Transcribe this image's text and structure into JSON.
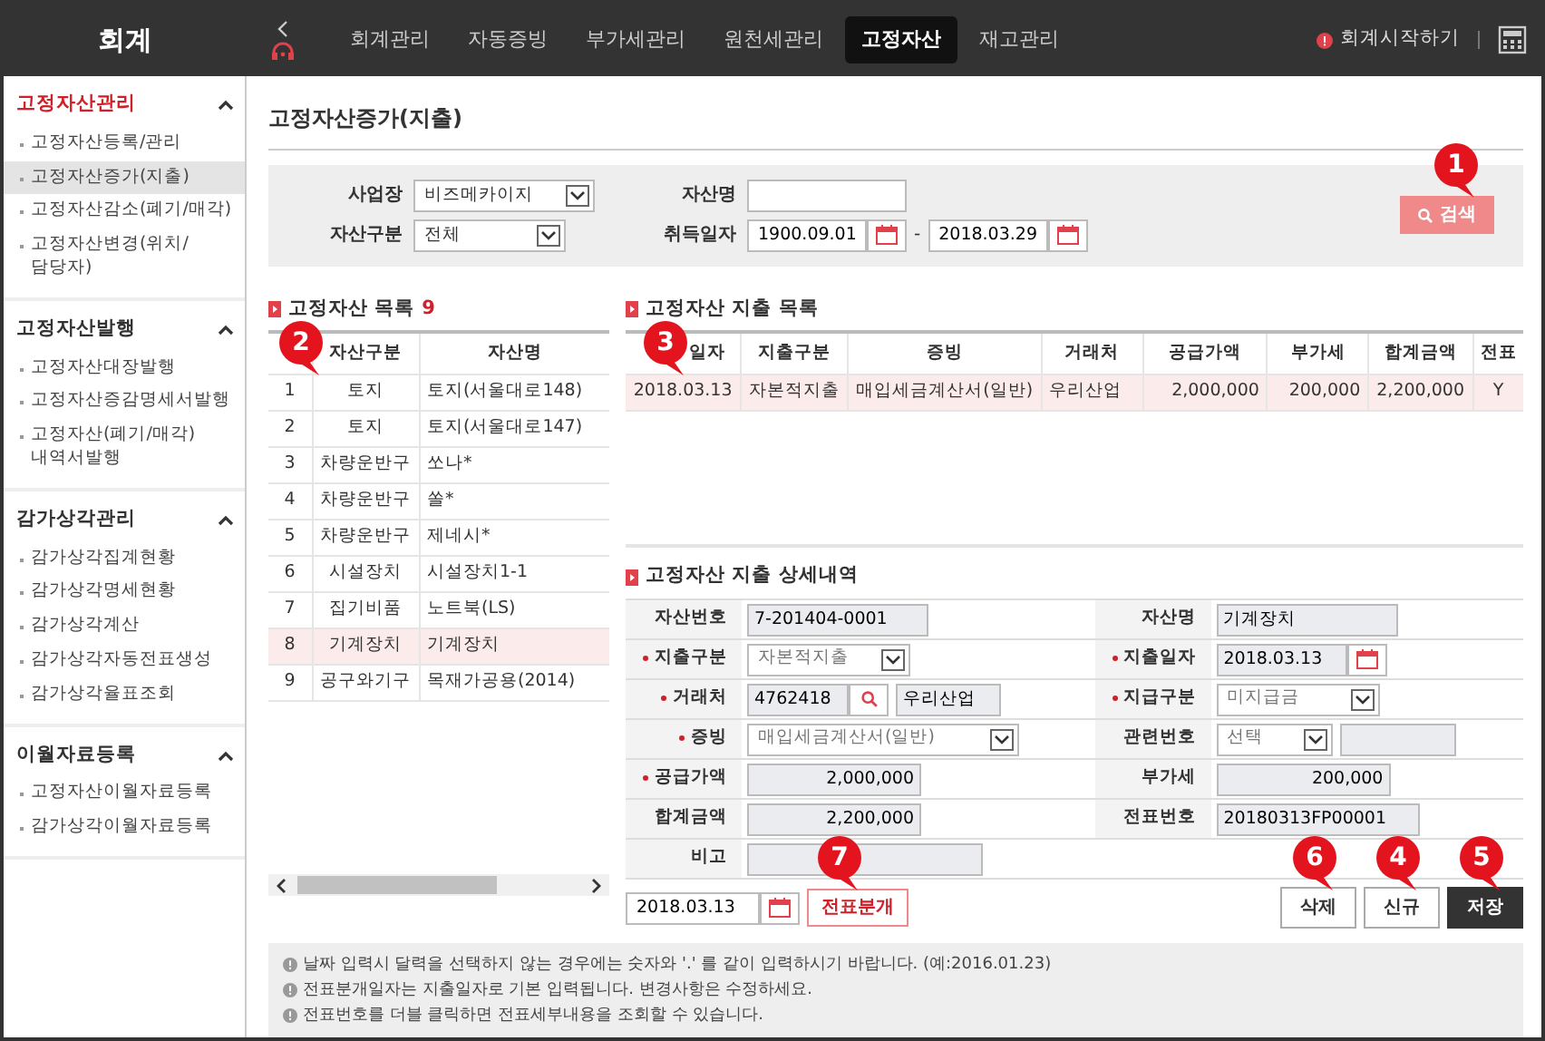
{
  "app": {
    "title": "회계",
    "start_link": "회계시작하기"
  },
  "nav_tabs": [
    {
      "label": "회계관리",
      "selected": false
    },
    {
      "label": "자동증빙",
      "selected": false
    },
    {
      "label": "부가세관리",
      "selected": false
    },
    {
      "label": "원천세관리",
      "selected": false
    },
    {
      "label": "고정자산",
      "selected": true
    },
    {
      "label": "재고관리",
      "selected": false
    }
  ],
  "sidebar": {
    "sections": [
      {
        "title": "고정자산관리",
        "selected": true,
        "expanded": true,
        "items": [
          {
            "label": "고정자산등록/관리",
            "selected": false
          },
          {
            "label": "고정자산증가(지출)",
            "selected": true
          },
          {
            "label": "고정자산감소(폐기/매각)",
            "selected": false
          },
          {
            "label": "고정자산변경(위치/\n담당자)",
            "selected": false
          }
        ]
      },
      {
        "title": "고정자산발행",
        "selected": false,
        "expanded": true,
        "items": [
          {
            "label": "고정자산대장발행",
            "selected": false
          },
          {
            "label": "고정자산증감명세서발행",
            "selected": false
          },
          {
            "label": "고정자산(폐기/매각)\n내역서발행",
            "selected": false
          }
        ]
      },
      {
        "title": "감가상각관리",
        "selected": false,
        "expanded": true,
        "items": [
          {
            "label": "감가상각집계현황",
            "selected": false
          },
          {
            "label": "감가상각명세현황",
            "selected": false
          },
          {
            "label": "감가상각계산",
            "selected": false
          },
          {
            "label": "감가상각자동전표생성",
            "selected": false
          },
          {
            "label": "감가상각율표조회",
            "selected": false
          }
        ]
      },
      {
        "title": "이월자료등록",
        "selected": false,
        "expanded": true,
        "items": [
          {
            "label": "고정자산이월자료등록",
            "selected": false
          },
          {
            "label": "감가상각이월자료등록",
            "selected": false
          }
        ]
      }
    ]
  },
  "page_title": "고정자산증가(지출)",
  "search": {
    "workplace_label": "사업장",
    "workplace": "비즈메카이지",
    "category_label": "자산구분",
    "category": "전체",
    "asset_name_label": "자산명",
    "date_label": "취득일자",
    "date_from": "1900.09.01",
    "date_sep": "-",
    "date_to": "2018.03.29",
    "button": "검색",
    "button_callout": "1"
  },
  "asset_list": {
    "title": "고정자산 목록",
    "count": "9",
    "header_callout": "2",
    "columns": [
      "자산구분",
      "자산명"
    ],
    "rows": [
      {
        "no": "1",
        "category": "토지",
        "name": "토지(서울대로148)",
        "selected": false
      },
      {
        "no": "2",
        "category": "토지",
        "name": "토지(서울대로147)",
        "selected": false
      },
      {
        "no": "3",
        "category": "차량운반구",
        "name": "쏘나*",
        "selected": false
      },
      {
        "no": "4",
        "category": "차량운반구",
        "name": "쏠*",
        "selected": false
      },
      {
        "no": "5",
        "category": "차량운반구",
        "name": "제네시*",
        "selected": false
      },
      {
        "no": "6",
        "category": "시설장치",
        "name": "시설장치1-1",
        "selected": false
      },
      {
        "no": "7",
        "category": "집기비품",
        "name": "노트북(LS)",
        "selected": false
      },
      {
        "no": "8",
        "category": "기계장치",
        "name": "기계장치",
        "selected": true
      },
      {
        "no": "9",
        "category": "공구와기구",
        "name": "목재가공용(2014)",
        "selected": false
      }
    ]
  },
  "expense_list": {
    "title": "고정자산 지출 목록",
    "header_callout": "3",
    "columns": [
      "일자",
      "지출구분",
      "증빙",
      "거래처",
      "공급가액",
      "부가세",
      "합계금액",
      "전표"
    ],
    "rows": [
      {
        "cells": [
          "2018.03.13",
          "자본적지출",
          "매입세금계산서(일반)",
          "우리산업",
          "2,000,000",
          "200,000",
          "2,200,000",
          "Y"
        ],
        "selected": true
      }
    ]
  },
  "detail": {
    "title": "고정자산 지출 상세내역",
    "rows": [
      [
        {
          "label": "자산번호",
          "required": false,
          "kind": "text",
          "value": "7-201404-0001"
        },
        {
          "label": "자산명",
          "required": false,
          "kind": "text",
          "value": "기계장치"
        }
      ],
      [
        {
          "label": "지출구분",
          "required": true,
          "kind": "select",
          "value": "자본적지출"
        },
        {
          "label": "지출일자",
          "required": true,
          "kind": "date",
          "value": "2018.03.13"
        }
      ],
      [
        {
          "label": "거래처",
          "required": true,
          "kind": "lookup",
          "value": "4762418",
          "value2": "우리산업"
        },
        {
          "label": "지급구분",
          "required": true,
          "kind": "select",
          "value": "미지급금"
        }
      ],
      [
        {
          "label": "증빙",
          "required": true,
          "kind": "select",
          "value": "매입세금계산서(일반)"
        },
        {
          "label": "관련번호",
          "required": false,
          "kind": "select_text",
          "value": "선택"
        }
      ],
      [
        {
          "label": "공급가액",
          "required": true,
          "kind": "amount",
          "value": "2,000,000"
        },
        {
          "label": "부가세",
          "required": false,
          "kind": "amount",
          "value": "200,000"
        }
      ],
      [
        {
          "label": "합계금액",
          "required": false,
          "kind": "amount",
          "value": "2,200,000"
        },
        {
          "label": "전표번호",
          "required": false,
          "kind": "text",
          "value": "20180313FP00001"
        }
      ],
      [
        {
          "label": "비고",
          "required": false,
          "kind": "text"
        }
      ]
    ]
  },
  "voucher": {
    "date": "2018.03.13",
    "button": "전표분개",
    "callout": "7"
  },
  "actions": [
    {
      "label": "삭제",
      "kind": "default",
      "callout": "6"
    },
    {
      "label": "신규",
      "kind": "default",
      "callout": "4"
    },
    {
      "label": "저장",
      "kind": "dark",
      "callout": "5"
    }
  ],
  "notes": [
    "날짜 입력시 달력을 선택하지 않는 경우에는 숫자와 '.' 를 같이 입력하시기 바랍니다. (예:2016.01.23)",
    "전표분개일자는 지출일자로 기본 입력됩니다. 변경사항은 수정하세요.",
    "전표번호를 더블 클릭하면 전표세부내용을 조회할 수 있습니다."
  ]
}
